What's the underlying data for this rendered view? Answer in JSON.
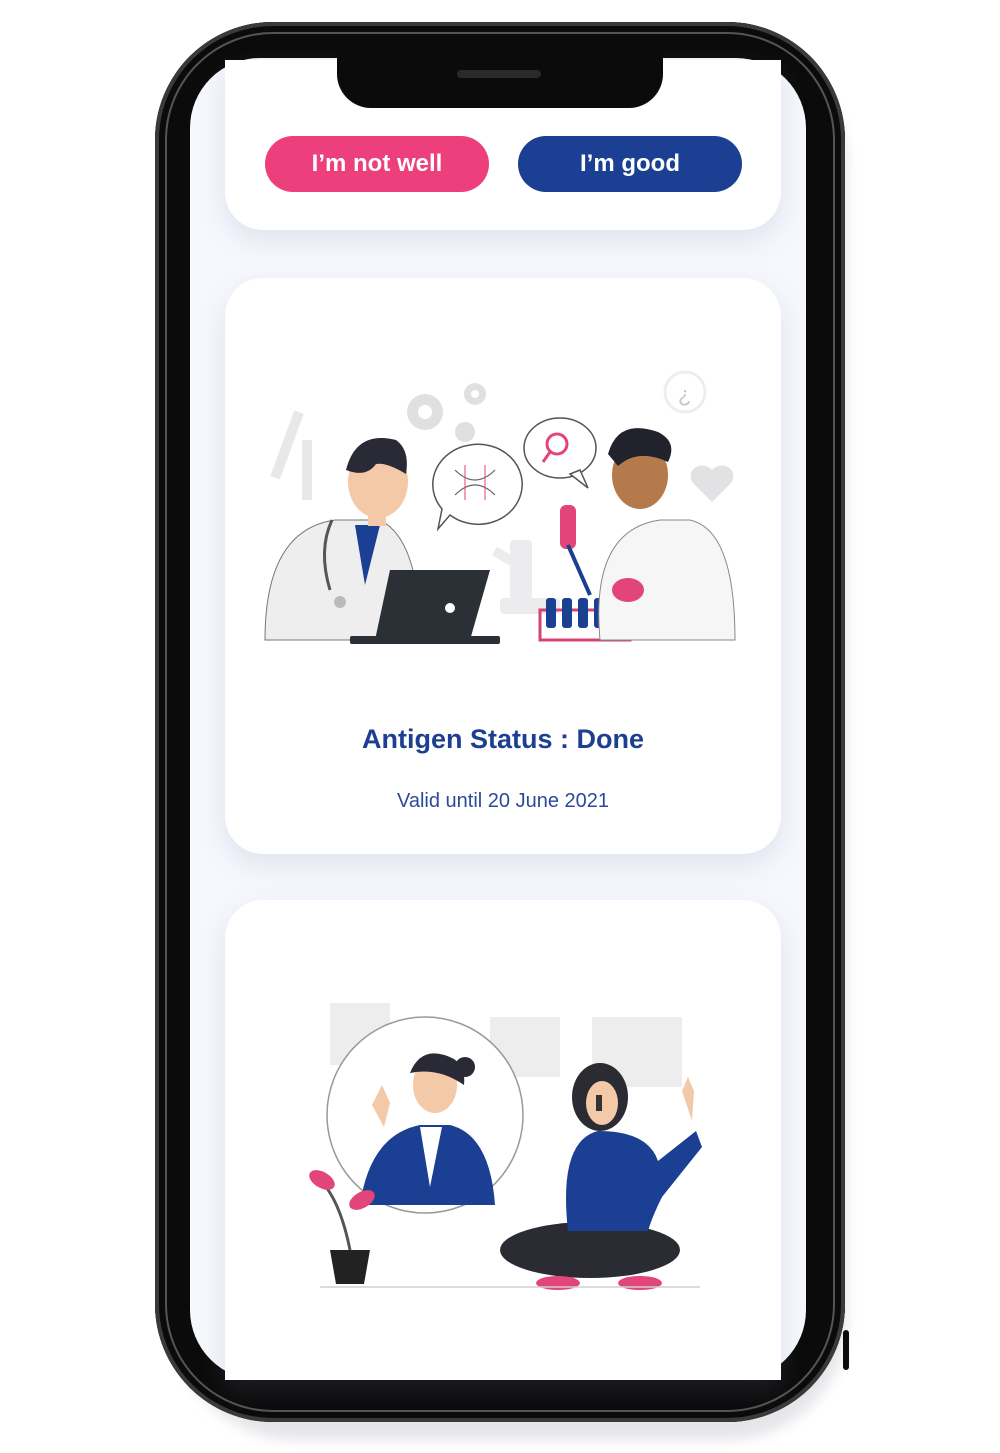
{
  "wellness": {
    "not_well_label": "I’m not well",
    "good_label": "I’m good"
  },
  "antigen": {
    "title": "Antigen Status : Done",
    "valid": "Valid until 20 June 2021"
  },
  "colors": {
    "pink": "#ec3f7b",
    "navy": "#1a3f93",
    "screen_bg": "#f6f8fd"
  },
  "icons": [
    "gear-icon",
    "magnifier-icon",
    "heart-icon",
    "question-icon",
    "dna-icon",
    "microscope-icon"
  ]
}
